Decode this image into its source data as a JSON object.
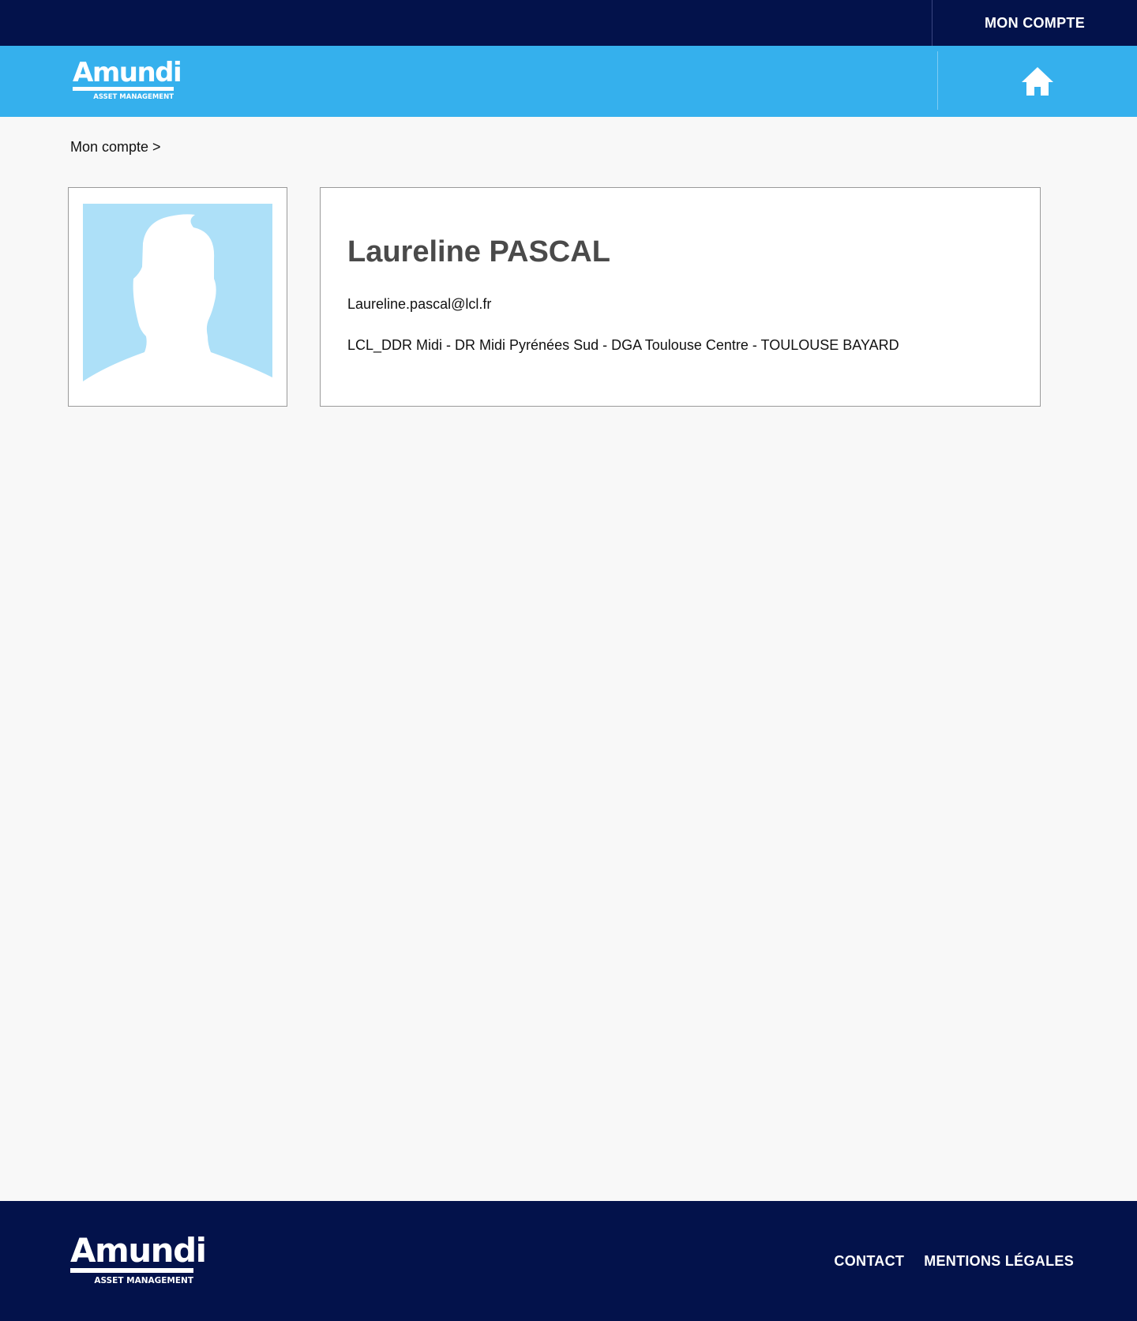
{
  "header": {
    "account_label": "MON COMPTE"
  },
  "brand": {
    "logo_word": "Amundi",
    "logo_sub": "ASSET MANAGEMENT",
    "color_navy": "#03124b",
    "color_blue": "#35b0ed"
  },
  "breadcrumb": {
    "label": "Mon compte >"
  },
  "profile": {
    "name": "Laureline PASCAL",
    "email": "Laureline.pascal@lcl.fr",
    "organization": "LCL_DDR Midi - DR Midi Pyrénées Sud - DGA Toulouse Centre - TOULOUSE BAYARD",
    "avatar_icon": "default-user-silhouette"
  },
  "footer": {
    "contact_label": "CONTACT",
    "legal_label": "MENTIONS LÉGALES"
  }
}
